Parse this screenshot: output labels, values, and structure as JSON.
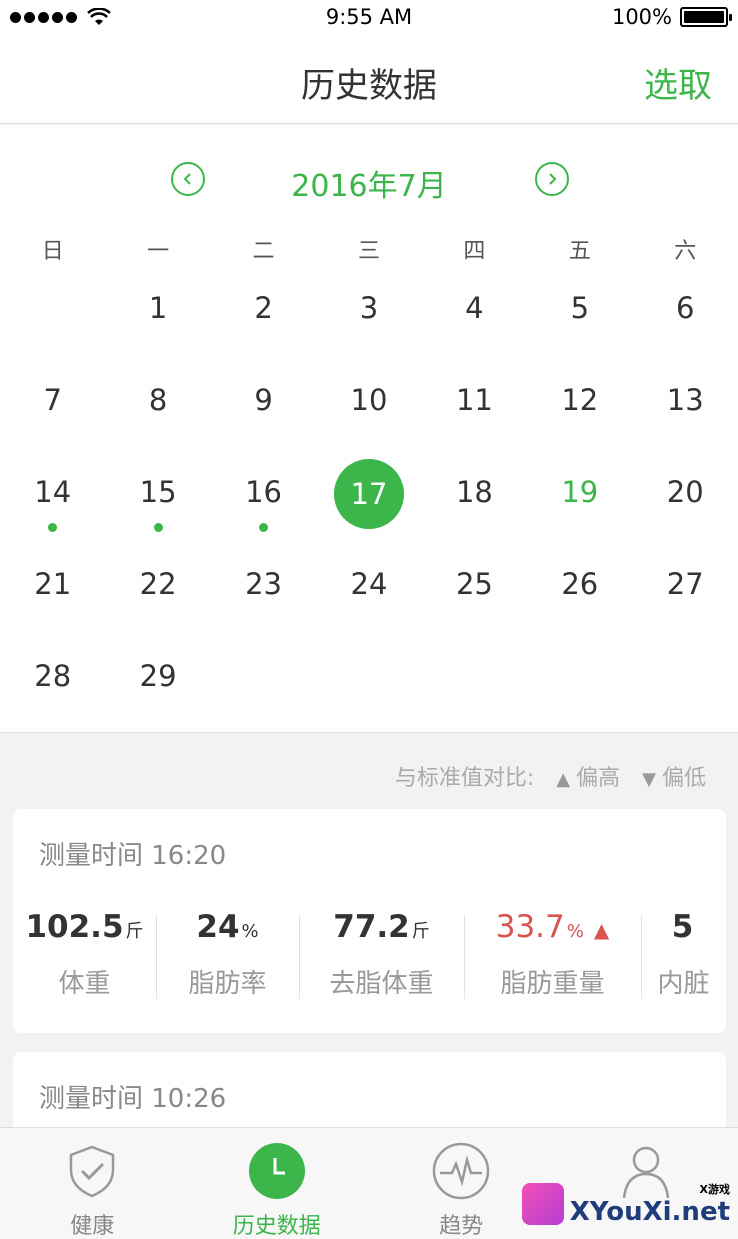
{
  "status_bar": {
    "time": "9:55 AM",
    "battery": "100%"
  },
  "nav": {
    "title": "历史数据",
    "action": "选取"
  },
  "calendar": {
    "month_label": "2016年7月",
    "weekdays": [
      "日",
      "一",
      "二",
      "三",
      "四",
      "五",
      "六"
    ],
    "leading_blanks": 1,
    "days": [
      "1",
      "2",
      "3",
      "4",
      "5",
      "6",
      "7",
      "8",
      "9",
      "10",
      "11",
      "12",
      "13",
      "14",
      "15",
      "16",
      "17",
      "18",
      "19",
      "20",
      "21",
      "22",
      "23",
      "24",
      "25",
      "26",
      "27",
      "28",
      "29"
    ],
    "selected_day": "17",
    "highlight_day": "19",
    "days_with_data": [
      "14",
      "15",
      "16"
    ]
  },
  "legend": {
    "prefix": "与标准值对比:",
    "high": "偏高",
    "low": "偏低"
  },
  "records": [
    {
      "time_label": "测量时间 16:20",
      "metrics": [
        {
          "value": "102.5",
          "unit": "斤",
          "label": "体重",
          "alert": false
        },
        {
          "value": "24",
          "unit": "%",
          "label": "脂肪率",
          "alert": false
        },
        {
          "value": "77.2",
          "unit": "斤",
          "label": "去脂体重",
          "alert": false
        },
        {
          "value": "33.7",
          "unit": "%",
          "label": "脂肪重量",
          "alert": true
        },
        {
          "value": "5",
          "unit": "",
          "label": "内脏",
          "alert": false
        }
      ]
    },
    {
      "time_label": "测量时间 10:26"
    }
  ],
  "tabs": [
    {
      "label": "健康",
      "icon": "shield-check-icon"
    },
    {
      "label": "历史数据",
      "icon": "clock-icon"
    },
    {
      "label": "趋势",
      "icon": "pulse-icon"
    },
    {
      "label": "",
      "icon": "person-icon"
    }
  ],
  "watermark": {
    "small": "X游戏",
    "main": "XYouXi.net"
  },
  "colors": {
    "accent": "#3cb54a",
    "alert": "#d9534f"
  }
}
